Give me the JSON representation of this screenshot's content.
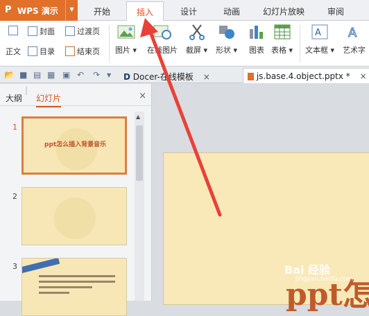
{
  "app": {
    "logo": "P",
    "name": "WPS 演示",
    "menu_arrow": "▼"
  },
  "menu_tabs": [
    "开始",
    "插入",
    "设计",
    "动画",
    "幻灯片放映",
    "审阅"
  ],
  "active_tab": "插入",
  "ribbon": {
    "small": [
      {
        "label": "封面",
        "icon": "cover-icon"
      },
      {
        "label": "过渡页",
        "icon": "transition-page-icon"
      },
      {
        "label": "正文",
        "icon": "body-icon"
      },
      {
        "label": "目录",
        "icon": "toc-icon"
      },
      {
        "label": "结束页",
        "icon": "end-page-icon"
      }
    ],
    "big": [
      {
        "label": "图片 ▾",
        "icon": "picture-icon"
      },
      {
        "label": "在线图片",
        "icon": "online-picture-icon"
      },
      {
        "label": "截屏 ▾",
        "icon": "screenshot-icon"
      },
      {
        "label": "形状 ▾",
        "icon": "shape-icon"
      },
      {
        "label": "图表",
        "icon": "chart-icon"
      },
      {
        "label": "表格 ▾",
        "icon": "table-icon"
      },
      {
        "label": "文本框 ▾",
        "icon": "textbox-icon"
      },
      {
        "label": "艺术字",
        "icon": "wordart-icon"
      }
    ]
  },
  "doc_tabs": [
    {
      "label": "Docer-在线模板",
      "close": "×"
    },
    {
      "label": "js.base.4.object.pptx *",
      "close": "×"
    }
  ],
  "panel": {
    "tabs": [
      "大纲",
      "幻灯片"
    ],
    "active_tab": "幻灯片",
    "close": "×",
    "slides": [
      {
        "number": "1",
        "title": "ppt怎么插入背景音乐"
      },
      {
        "number": "2",
        "title": ""
      },
      {
        "number": "3",
        "title": ""
      }
    ]
  },
  "canvas": {
    "title_text": "ppt怎"
  },
  "watermark": {
    "text": "Bai 经验",
    "sub": "jingyan.baidu.com"
  },
  "colors": {
    "accent": "#d9531e",
    "arrow": "#e8413a",
    "app_button": "#e0702a",
    "slide_bg": "#f9e9b9"
  }
}
